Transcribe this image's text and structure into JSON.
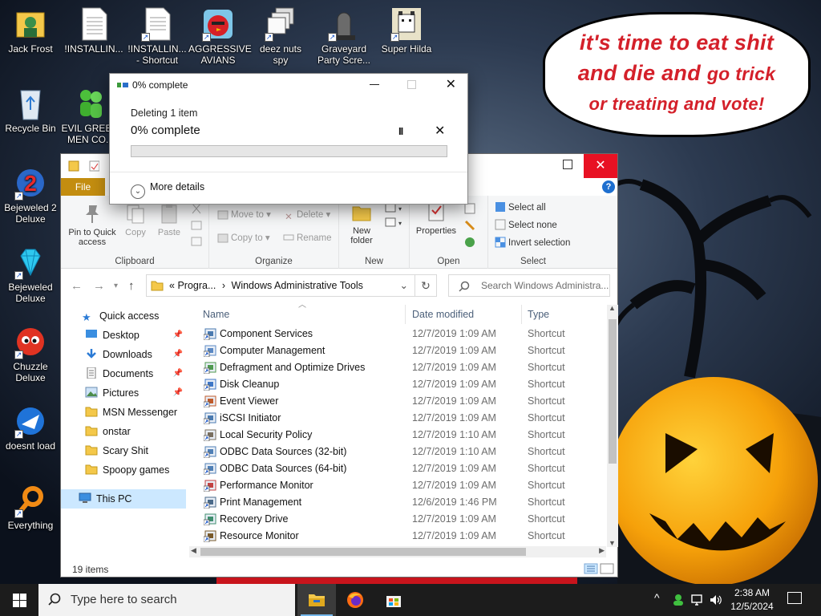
{
  "desktop": {
    "icons": [
      {
        "label": "Jack Frost",
        "icon": "folder-portrait-icon"
      },
      {
        "label": "!INSTALLIN...",
        "icon": "document-icon"
      },
      {
        "label": "!INSTALLIN... - Shortcut",
        "icon": "document-shortcut-icon"
      },
      {
        "label": "AGGRESSIVE AVIANS",
        "icon": "angry-bird-icon"
      },
      {
        "label": "deez nuts spy",
        "icon": "windows-stack-icon"
      },
      {
        "label": "Graveyard Party Scre...",
        "icon": "graveyard-icon"
      },
      {
        "label": "Super Hilda",
        "icon": "pixel-cat-icon"
      },
      {
        "label": "Recycle Bin",
        "icon": "recycle-bin-icon"
      },
      {
        "label": "EVIL GREE... MEN CO...",
        "icon": "green-men-icon"
      },
      {
        "label": "Bejeweled 2 Deluxe",
        "icon": "bejeweled2-icon"
      },
      {
        "label": "Bejeweled Deluxe",
        "icon": "diamond-icon"
      },
      {
        "label": "Chuzzle Deluxe",
        "icon": "chuzzle-icon"
      },
      {
        "label": "doesnt load",
        "icon": "thunderbird-icon"
      },
      {
        "label": "Everything",
        "icon": "magnifier-icon"
      }
    ]
  },
  "bubble": {
    "line1": "it's time to eat shit",
    "line2a": "and die and",
    "line2b": "go trick",
    "line3": "or treating and vote!"
  },
  "dialog": {
    "title": "0% complete",
    "line1": "Deleting 1 item",
    "line2": "0% complete",
    "progress": 0,
    "more_details": "More details",
    "pause_glyph": "II",
    "stop_glyph": "✕",
    "close_glyph": "✕"
  },
  "explorer": {
    "tab_file": "File",
    "help_glyph": "?",
    "ribbon": {
      "clipboard": {
        "name": "Clipboard",
        "pin": "Pin to Quick access",
        "copy": "Copy",
        "paste": "Paste"
      },
      "organize": {
        "name": "Organize",
        "move_to": "Move to",
        "copy_to": "Copy to",
        "delete": "Delete",
        "rename": "Rename"
      },
      "new": {
        "name": "New",
        "new_folder": "New folder"
      },
      "open": {
        "name": "Open",
        "properties": "Properties"
      },
      "select": {
        "name": "Select",
        "select_all": "Select all",
        "select_none": "Select none",
        "invert": "Invert selection"
      }
    },
    "address": {
      "prefix": "«",
      "part1": "Progra...",
      "sep": "›",
      "part2": "Windows Administrative Tools"
    },
    "search_placeholder": "Search Windows Administra...",
    "nav": [
      {
        "label": "Quick access",
        "pinned": false
      },
      {
        "label": "Desktop",
        "pinned": true
      },
      {
        "label": "Downloads",
        "pinned": true
      },
      {
        "label": "Documents",
        "pinned": true
      },
      {
        "label": "Pictures",
        "pinned": true
      },
      {
        "label": "MSN Messenger",
        "pinned": false
      },
      {
        "label": "onstar",
        "pinned": false
      },
      {
        "label": "Scary Shit",
        "pinned": false
      },
      {
        "label": "Spoopy games",
        "pinned": false
      },
      {
        "label": "This PC",
        "pinned": false
      }
    ],
    "columns": {
      "name": "Name",
      "date": "Date modified",
      "type": "Type"
    },
    "files": [
      {
        "name": "Component Services",
        "date": "12/7/2019 1:09 AM",
        "type": "Shortcut"
      },
      {
        "name": "Computer Management",
        "date": "12/7/2019 1:09 AM",
        "type": "Shortcut"
      },
      {
        "name": "Defragment and Optimize Drives",
        "date": "12/7/2019 1:09 AM",
        "type": "Shortcut"
      },
      {
        "name": "Disk Cleanup",
        "date": "12/7/2019 1:09 AM",
        "type": "Shortcut"
      },
      {
        "name": "Event Viewer",
        "date": "12/7/2019 1:09 AM",
        "type": "Shortcut"
      },
      {
        "name": "iSCSI Initiator",
        "date": "12/7/2019 1:09 AM",
        "type": "Shortcut"
      },
      {
        "name": "Local Security Policy",
        "date": "12/7/2019 1:10 AM",
        "type": "Shortcut"
      },
      {
        "name": "ODBC Data Sources (32-bit)",
        "date": "12/7/2019 1:10 AM",
        "type": "Shortcut"
      },
      {
        "name": "ODBC Data Sources (64-bit)",
        "date": "12/7/2019 1:09 AM",
        "type": "Shortcut"
      },
      {
        "name": "Performance Monitor",
        "date": "12/7/2019 1:09 AM",
        "type": "Shortcut"
      },
      {
        "name": "Print Management",
        "date": "12/6/2019 1:46 PM",
        "type": "Shortcut"
      },
      {
        "name": "Recovery Drive",
        "date": "12/7/2019 1:09 AM",
        "type": "Shortcut"
      },
      {
        "name": "Resource Monitor",
        "date": "12/7/2019 1:09 AM",
        "type": "Shortcut"
      }
    ],
    "status": "19 items"
  },
  "taskbar": {
    "search_placeholder": "Type here to search",
    "apps": [
      "file-explorer-icon",
      "firefox-icon",
      "store-icon"
    ],
    "time": "2:38 AM",
    "date": "12/5/2024"
  }
}
